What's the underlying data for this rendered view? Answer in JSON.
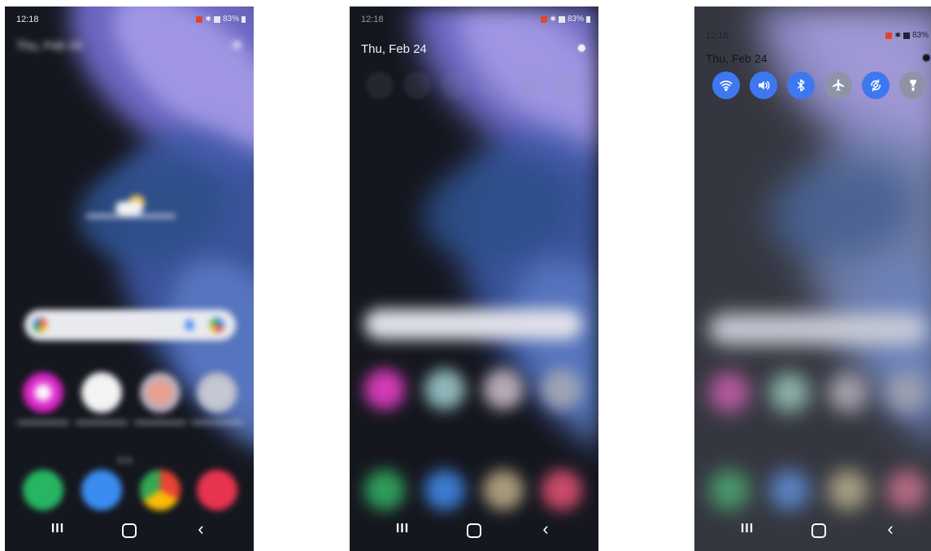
{
  "screens": [
    {
      "id": "home",
      "status": {
        "time": "12:18",
        "battery": "83%"
      },
      "date": "Thu, Feb 24"
    },
    {
      "id": "shade-opening",
      "status": {
        "time": "12:18",
        "battery": "83%"
      },
      "date": "Thu, Feb 24"
    },
    {
      "id": "quick-panel",
      "status": {
        "time": "12:18",
        "battery": "83%"
      },
      "date": "Thu, Feb 24",
      "quick_settings": [
        {
          "name": "wifi-icon",
          "state": "on"
        },
        {
          "name": "sound-icon",
          "state": "on"
        },
        {
          "name": "bluetooth-icon",
          "state": "on"
        },
        {
          "name": "airplane-mode-icon",
          "state": "off"
        },
        {
          "name": "auto-rotate-icon",
          "state": "on"
        },
        {
          "name": "flashlight-icon",
          "state": "off"
        }
      ]
    }
  ],
  "navbar": {
    "recent": "III",
    "back": "‹"
  },
  "colors": {
    "accent_on": "#3e78f0",
    "toggle_off": "#8f93a8",
    "background": "#15171f"
  }
}
